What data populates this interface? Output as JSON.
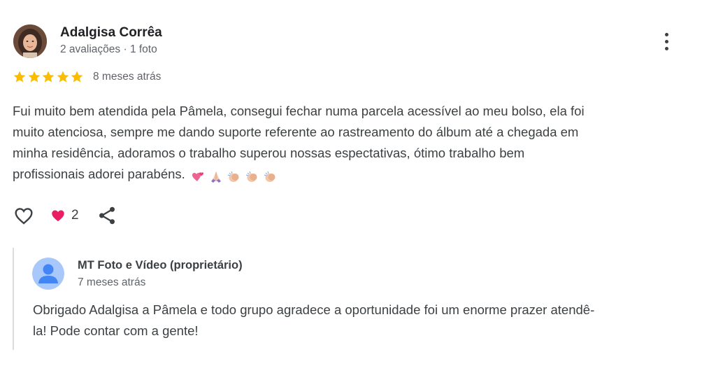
{
  "review": {
    "author": {
      "name": "Adalgisa Corrêa",
      "meta": "2 avaliações · 1 foto"
    },
    "rating": 5,
    "time": "8 meses atrás",
    "text_lines": [
      "Fui muito bem atendida pela Pâmela, consegui fechar numa parcela acessível ao meu bolso, ela foi",
      "muito atenciosa, sempre me dando suporte referente ao rastreamento do álbum até a chegada em",
      "minha residência, adoramos o trabalho superou nossas espectativas, ótimo trabalho bem",
      "profissionais adorei parabéns."
    ],
    "emojis": [
      "two-hearts",
      "folded-hands",
      "clapping-hands",
      "clapping-hands",
      "clapping-hands"
    ],
    "reactions": {
      "count": "2"
    }
  },
  "owner_reply": {
    "name": "MT Foto e Vídeo (proprietário)",
    "time": "7 meses atrás",
    "text_lines": [
      "Obrigado Adalgisa a Pâmela e todo grupo agradece a oportunidade foi um enorme prazer atendê-",
      "la! Pode contar com a gente!"
    ]
  },
  "colors": {
    "star": "#fbbc04",
    "heart": "#e91e63",
    "avatar_blue": "#a8c7fa",
    "avatar_blue_dark": "#4285f4",
    "reply_border": "#dadce0"
  },
  "icons": {
    "more": "more-vert-icon",
    "like": "heart-outline-icon",
    "reaction": "heart-filled-icon",
    "share": "share-icon"
  }
}
